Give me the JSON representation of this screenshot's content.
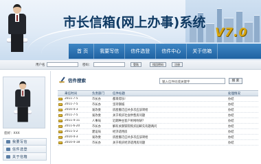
{
  "header": {
    "title": "市长信箱(网上办事)系统",
    "version": "V7.0"
  },
  "nav": {
    "items": [
      "首  页",
      "我要写信",
      "信件选登",
      "信件中心",
      "关于信箱"
    ]
  },
  "login_bar": {
    "username_label": "用户名",
    "password_label": "密码：",
    "login_button": "登陆",
    "forgot_button": "找回密码",
    "register_button": "注册"
  },
  "sidebar": {
    "user_line": "您好：XXX",
    "menu": [
      "我要写信",
      "信件选登",
      "关于信箱"
    ]
  },
  "search": {
    "title": "信件搜索",
    "input_value": "输入信件码或关键字",
    "button": "搜 索"
  },
  "table": {
    "headers": [
      "来信时间",
      "负责部门",
      "信件标题",
      "处理情况"
    ],
    "rows": [
      {
        "date": "2011-7-5",
        "dept": "市长办",
        "title": "都来得乐!",
        "status": "办结"
      },
      {
        "date": "2011-7-5",
        "dept": "市长办",
        "title": "坚持钢城",
        "status": "办结"
      },
      {
        "date": "2010-4-3",
        "dept": "发改委",
        "title": "房屋搬迁应补多次应该转给",
        "status": "办结"
      },
      {
        "date": "2011-7-5",
        "dept": "发改委",
        "title": "关于购买社会供售房问题",
        "status": "办结"
      },
      {
        "date": "2011-4-11",
        "dept": "人事局",
        "title": "近期种主客户咐咐咐研？",
        "status": "办结"
      },
      {
        "date": "2011-6-20",
        "dept": "市长办",
        "title": "解有关钢铁院购买园邮先有题两问",
        "status": "办结"
      },
      {
        "date": "2011-5-2",
        "dept": "建设局",
        "title": "经济适用房",
        "status": "办结"
      },
      {
        "date": "2010-4-3",
        "dept": "发改委",
        "title": "房屋搬迁应补多次应该转给",
        "status": "办结"
      },
      {
        "date": "2010-4-18",
        "dept": "市长办",
        "title": "关于购买经济适用房问题",
        "status": "办结"
      }
    ]
  },
  "colors": {
    "nav_blue": "#1f62a2",
    "title_blue": "#0f3a63",
    "version_gold": "#d9a60f",
    "mail_icon": "#e8c340"
  }
}
